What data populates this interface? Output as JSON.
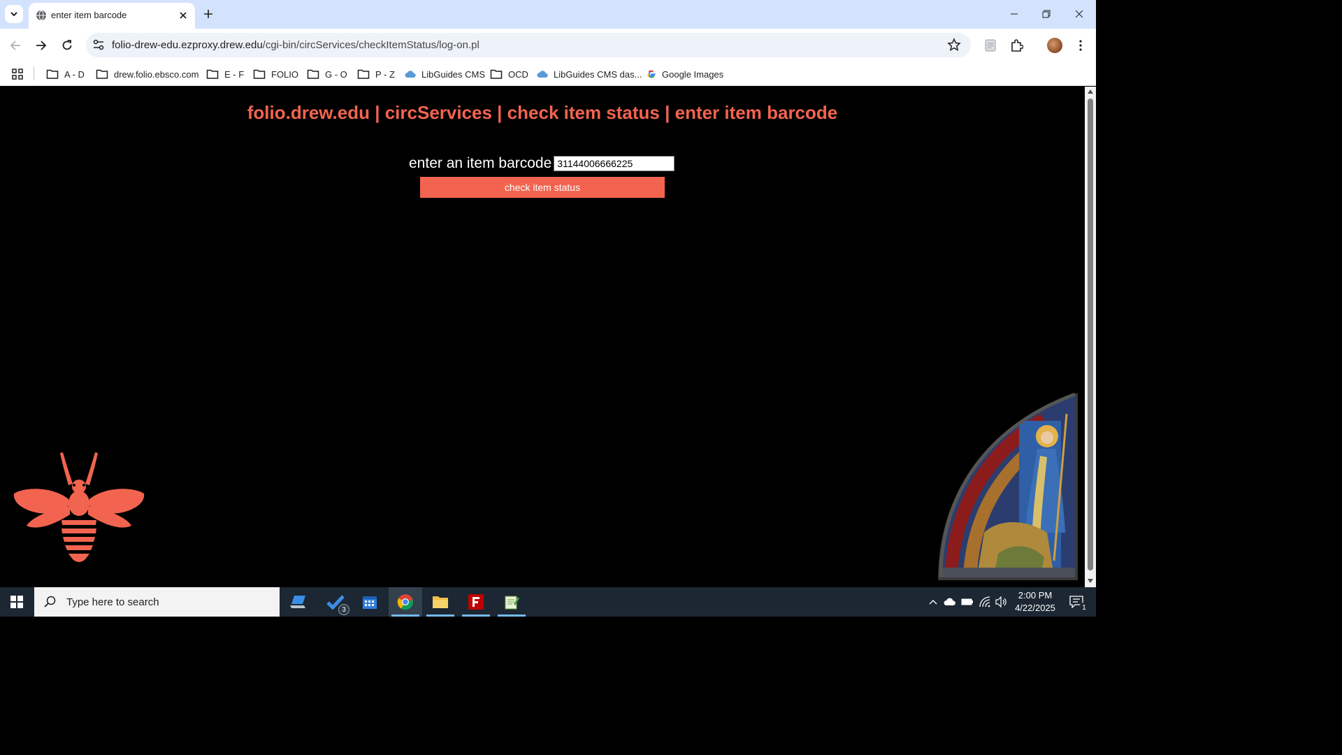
{
  "browser": {
    "tab_title": "enter item barcode",
    "url_host": "folio-drew-edu.ezproxy.drew.edu",
    "url_path": "/cgi-bin/circServices/checkItemStatus/log-on.pl"
  },
  "bookmarks": [
    {
      "label": "A - D",
      "icon": "folder-icon"
    },
    {
      "label": "drew.folio.ebsco.com",
      "icon": "folder-icon"
    },
    {
      "label": "E - F",
      "icon": "folder-icon"
    },
    {
      "label": "FOLIO",
      "icon": "folder-icon"
    },
    {
      "label": "G - O",
      "icon": "folder-icon"
    },
    {
      "label": "P - Z",
      "icon": "folder-icon"
    },
    {
      "label": "LibGuides CMS",
      "icon": "cloud-icon"
    },
    {
      "label": "OCD",
      "icon": "folder-icon"
    },
    {
      "label": "LibGuides CMS das...",
      "icon": "cloud-icon"
    },
    {
      "label": "Google Images",
      "icon": "google-icon"
    }
  ],
  "page": {
    "heading": "folio.drew.edu | circServices | check item status | enter item barcode",
    "barcode_label": "enter an item barcode",
    "barcode_value": "31144006666225",
    "submit_label": "check item status",
    "accent_color": "#f2644f"
  },
  "taskbar": {
    "search_placeholder": "Type here to search",
    "todo_badge": "3",
    "time": "2:00 PM",
    "date": "4/22/2025",
    "notification_count": "1"
  }
}
